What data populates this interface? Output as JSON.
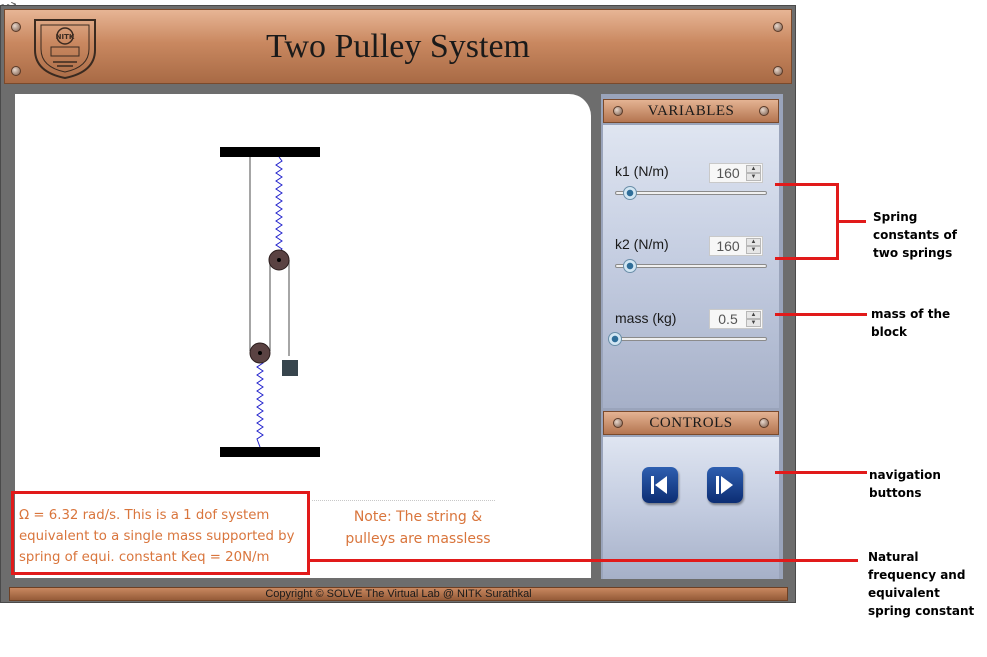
{
  "corner_mark": "-->",
  "app": {
    "title": "Two Pulley System",
    "logo_text": "NITK"
  },
  "variables_panel": {
    "title": "VARIABLES",
    "k1": {
      "label": "k1 (N/m)",
      "value": "160",
      "slider_fraction": 0.06
    },
    "k2": {
      "label": "k2 (N/m)",
      "value": "160",
      "slider_fraction": 0.06
    },
    "mass": {
      "label": "mass (kg)",
      "value": "0.5",
      "slider_fraction": 0.0
    }
  },
  "controls_panel": {
    "title": "CONTROLS",
    "prev_icon": "skip-back-icon",
    "next_icon": "skip-forward-icon"
  },
  "info": {
    "result_text": "Ω = 6.32 rad/s. This is a 1 dof system equivalent to a single mass supported by spring of equi. constant Keq = 20N/m",
    "note_text": "Note: The string & pulleys are massless"
  },
  "footer": "Copyright © SOLVE The Virtual Lab @ NITK Surathkal",
  "annotations": {
    "springs": "Spring constants of two springs",
    "mass": "mass of the block",
    "nav": "navigation buttons",
    "natural": "Natural frequency and equivalent spring constant"
  },
  "colors": {
    "header_brown": "#c98860",
    "spring_blue": "#2222cc",
    "annotation_red": "#e11a1a",
    "info_orange": "#d9753c",
    "button_blue": "#1a4494"
  }
}
